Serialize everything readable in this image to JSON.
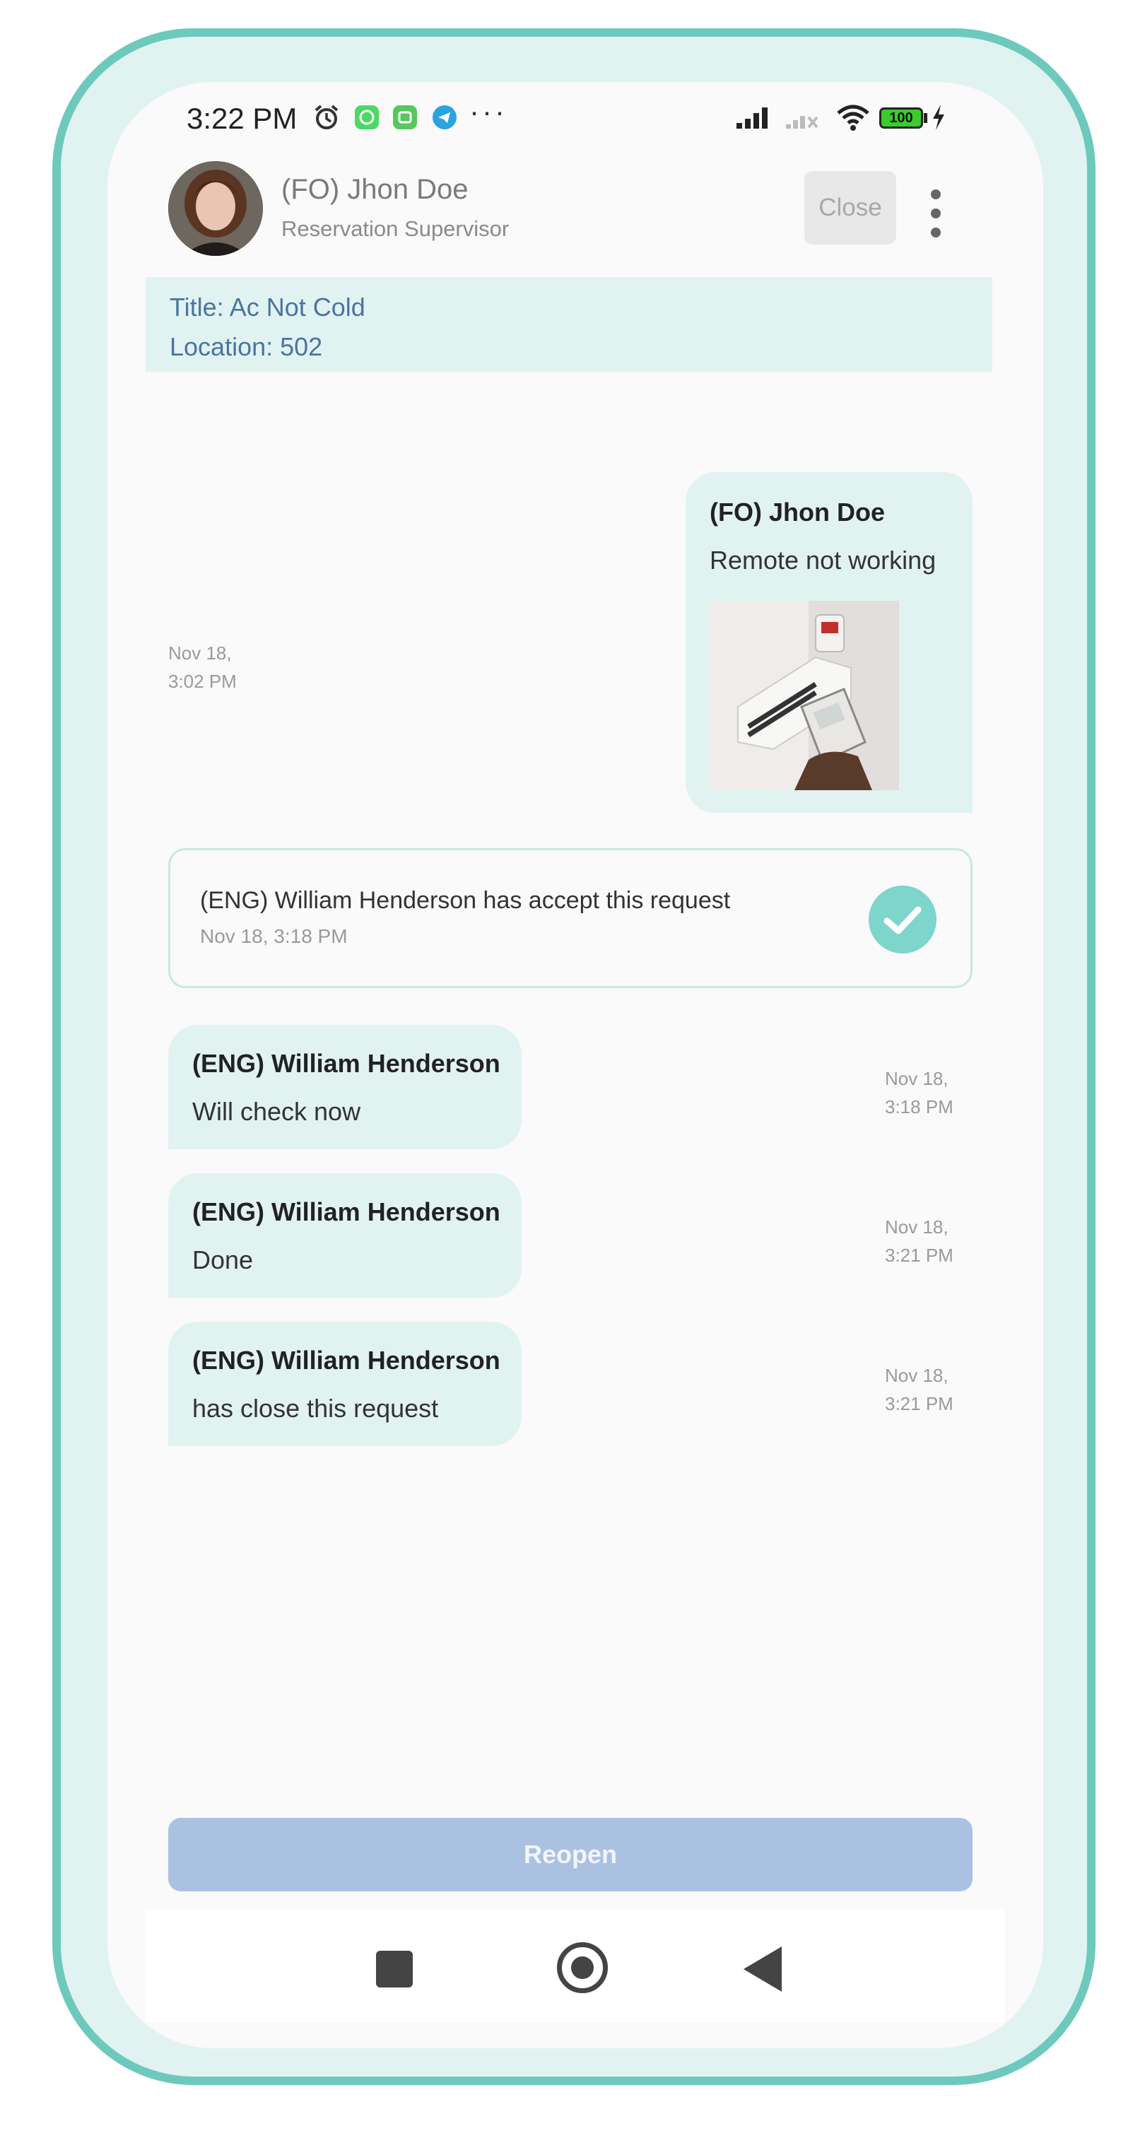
{
  "status_bar": {
    "time": "3:22 PM",
    "icons": [
      "alarm-icon",
      "whatsapp-icon",
      "android-app-icon",
      "telegram-icon"
    ],
    "battery": "100"
  },
  "header": {
    "name": "(FO) Jhon Doe",
    "role": "Reservation Supervisor",
    "close_label": "Close"
  },
  "ticket": {
    "title": "Title: Ac Not Cold",
    "location": "Location: 502"
  },
  "messages": [
    {
      "author": "(FO) Jhon Doe",
      "text": "Remote not working",
      "time_date": "Nov 18,",
      "time_clock": "3:02 PM",
      "has_image": true
    },
    {
      "author": "(ENG) William Henderson",
      "text": "Will check now",
      "time_date": "Nov 18,",
      "time_clock": "3:18 PM"
    },
    {
      "author": "(ENG) William Henderson",
      "text": "Done",
      "time_date": "Nov 18,",
      "time_clock": "3:21 PM"
    },
    {
      "author": "(ENG) William Henderson",
      "text": "has close this request",
      "time_date": "Nov 18,",
      "time_clock": "3:21 PM"
    }
  ],
  "system_event": {
    "text": "(ENG) William Henderson has accept this request",
    "time": "Nov 18, 3:18 PM"
  },
  "footer": {
    "reopen_label": "Reopen"
  },
  "colors": {
    "frame": "#6ec9bd",
    "bubble": "#e1f3f1",
    "accent_check": "#7dd5cb",
    "reopen_button": "#abc1e2",
    "ticket_text": "#4a74a2"
  }
}
